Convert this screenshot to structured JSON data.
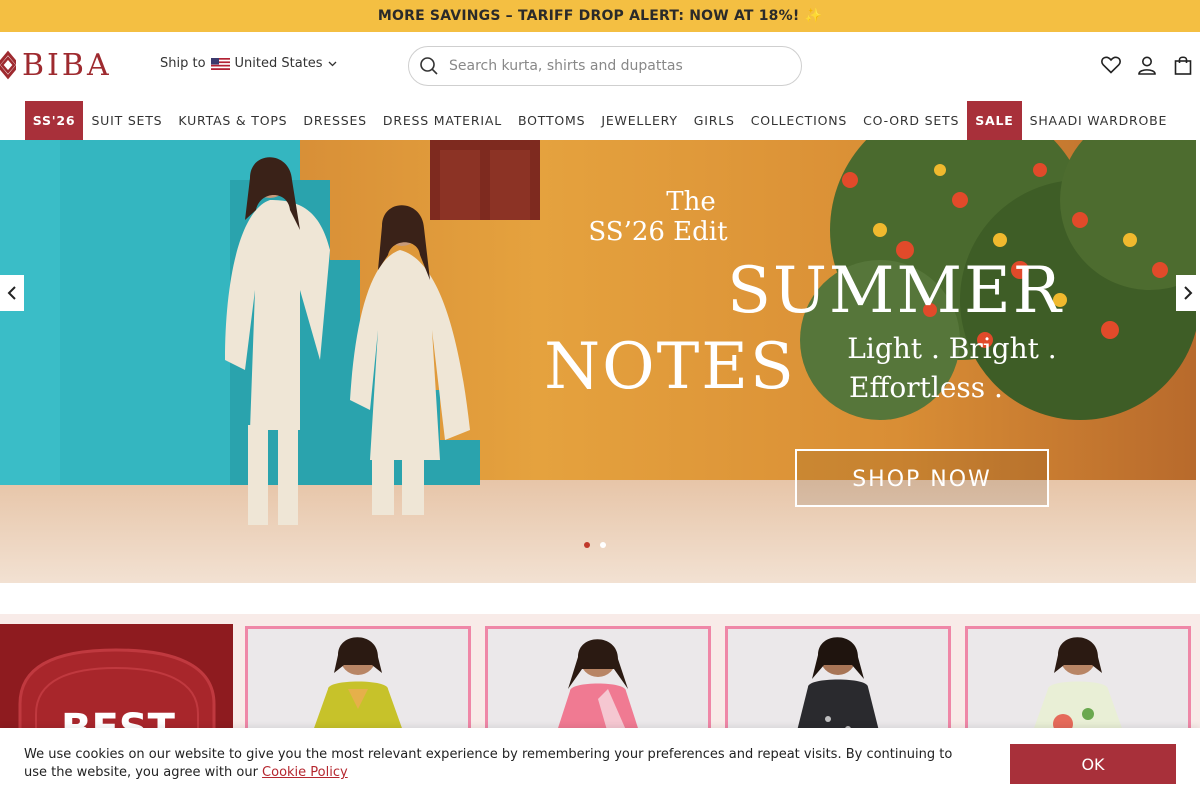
{
  "announcement": {
    "text": "MORE SAVINGS – TARIFF DROP ALERT: NOW AT 18%! ✨"
  },
  "header": {
    "logo_text": "BIBA",
    "ship_to_label": "Ship to",
    "country": "United States",
    "search_placeholder": "Search kurta, shirts and dupattas",
    "icons": [
      "heart-icon",
      "user-icon",
      "bag-icon"
    ]
  },
  "nav": {
    "items": [
      {
        "label": "SS'26",
        "highlight": true
      },
      {
        "label": "SUIT SETS",
        "highlight": false
      },
      {
        "label": "KURTAS & TOPS",
        "highlight": false
      },
      {
        "label": "DRESSES",
        "highlight": false
      },
      {
        "label": "DRESS MATERIAL",
        "highlight": false
      },
      {
        "label": "BOTTOMS",
        "highlight": false
      },
      {
        "label": "JEWELLERY",
        "highlight": false
      },
      {
        "label": "GIRLS",
        "highlight": false
      },
      {
        "label": "COLLECTIONS",
        "highlight": false
      },
      {
        "label": "CO-ORD SETS",
        "highlight": false
      },
      {
        "label": "SALE",
        "highlight": true
      },
      {
        "label": "SHAADI WARDROBE",
        "highlight": false
      }
    ]
  },
  "hero": {
    "the": "The",
    "edit": "SS’26 Edit",
    "summer": "SUMMER",
    "notes": "NOTES",
    "tag1": "Light . Bright .",
    "tag2": "Effortless .",
    "cta": "SHOP NOW",
    "slide_count": 2,
    "active_slide": 1
  },
  "promo": {
    "text": "BEST"
  },
  "cookie": {
    "text": "We use cookies on our website to give you the most relevant experience by remembering your preferences and repeat visits. By continuing to use the website, you agree with our ",
    "link": "Cookie Policy",
    "ok": "OK"
  },
  "colors": {
    "brand": "#a8303a",
    "announce_bg": "#f4bf42",
    "card_border": "#ef87a7"
  }
}
